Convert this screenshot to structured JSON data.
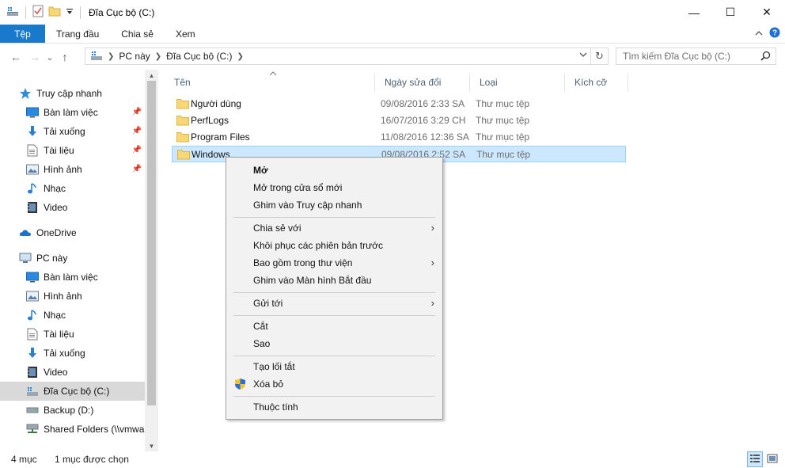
{
  "title": "Đĩa Cục bộ (C:)",
  "window_controls": {
    "minimize": "—",
    "maximize": "☐",
    "close": "✕"
  },
  "ribbon": {
    "tabs": [
      "Tệp",
      "Trang đầu",
      "Chia sẻ",
      "Xem"
    ],
    "help_symbol": "?"
  },
  "address": {
    "back": "←",
    "forward": "→",
    "recent": "⌄",
    "up": "↑",
    "crumbs": [
      "PC này",
      "Đĩa Cục bộ (C:)"
    ],
    "refresh": "↻"
  },
  "search": {
    "placeholder": "Tìm kiếm Đĩa Cục bộ (C:)"
  },
  "nav": {
    "items": [
      {
        "label": "Truy cập nhanh",
        "icon": "star-icon",
        "pinned": false
      },
      {
        "label": "Bàn làm việc",
        "icon": "desktop-icon",
        "pinned": true
      },
      {
        "label": "Tải xuống",
        "icon": "download-icon",
        "pinned": true
      },
      {
        "label": "Tài liệu",
        "icon": "document-icon",
        "pinned": true
      },
      {
        "label": "Hình ảnh",
        "icon": "picture-icon",
        "pinned": true
      },
      {
        "label": "Nhạc",
        "icon": "music-icon",
        "pinned": false
      },
      {
        "label": "Video",
        "icon": "video-icon",
        "pinned": false
      },
      {
        "label": "OneDrive",
        "icon": "cloud-icon",
        "pinned": false
      },
      {
        "label": "PC này",
        "icon": "computer-icon",
        "pinned": false
      },
      {
        "label": "Bàn làm việc",
        "icon": "desktop-icon",
        "pinned": false
      },
      {
        "label": "Hình ảnh",
        "icon": "picture-icon",
        "pinned": false
      },
      {
        "label": "Nhạc",
        "icon": "music-icon",
        "pinned": false
      },
      {
        "label": "Tài liệu",
        "icon": "document-icon",
        "pinned": false
      },
      {
        "label": "Tải xuống",
        "icon": "download-icon",
        "pinned": false
      },
      {
        "label": "Video",
        "icon": "video-icon",
        "pinned": false
      },
      {
        "label": "Đĩa Cục bộ (C:)",
        "icon": "drive-icon",
        "pinned": false,
        "selected": true
      },
      {
        "label": "Backup (D:)",
        "icon": "drive-icon",
        "pinned": false
      },
      {
        "label": "Shared Folders (\\\\vmwar",
        "icon": "network-drive-icon",
        "pinned": false
      }
    ]
  },
  "columns": [
    "Tên",
    "Ngày sửa đổi",
    "Loại",
    "Kích cỡ"
  ],
  "files": [
    {
      "name": "Người dùng",
      "date": "09/08/2016 2:33 SA",
      "type": "Thư mục tệp"
    },
    {
      "name": "PerfLogs",
      "date": "16/07/2016 3:29 CH",
      "type": "Thư mục tệp"
    },
    {
      "name": "Program Files",
      "date": "11/08/2016 12:36 SA",
      "type": "Thư mục tệp"
    },
    {
      "name": "Windows",
      "date": "09/08/2016 2:52 SA",
      "type": "Thư mục tệp",
      "selected": true
    }
  ],
  "context_menu": {
    "open": "Mở",
    "open_new_window": "Mở trong cửa sổ mới",
    "pin_quick_access": "Ghim vào Truy cập nhanh",
    "share_with": "Chia sẻ với",
    "restore_versions": "Khôi phục các phiên bản trước",
    "include_library": "Bao gồm trong thư viện",
    "pin_start": "Ghim vào Màn hình Bắt đầu",
    "send_to": "Gửi tới",
    "cut": "Cắt",
    "copy": "Sao",
    "create_shortcut": "Tạo lối tắt",
    "delete": "Xóa bỏ",
    "properties": "Thuộc tính",
    "submenu_arrow": "›"
  },
  "status": {
    "count": "4 mục",
    "selected": "1 mục được chọn"
  },
  "colors": {
    "accent": "#1979ca",
    "selection": "#cce8ff",
    "selection_border": "#99d1ff",
    "folder": "#f8d775"
  }
}
